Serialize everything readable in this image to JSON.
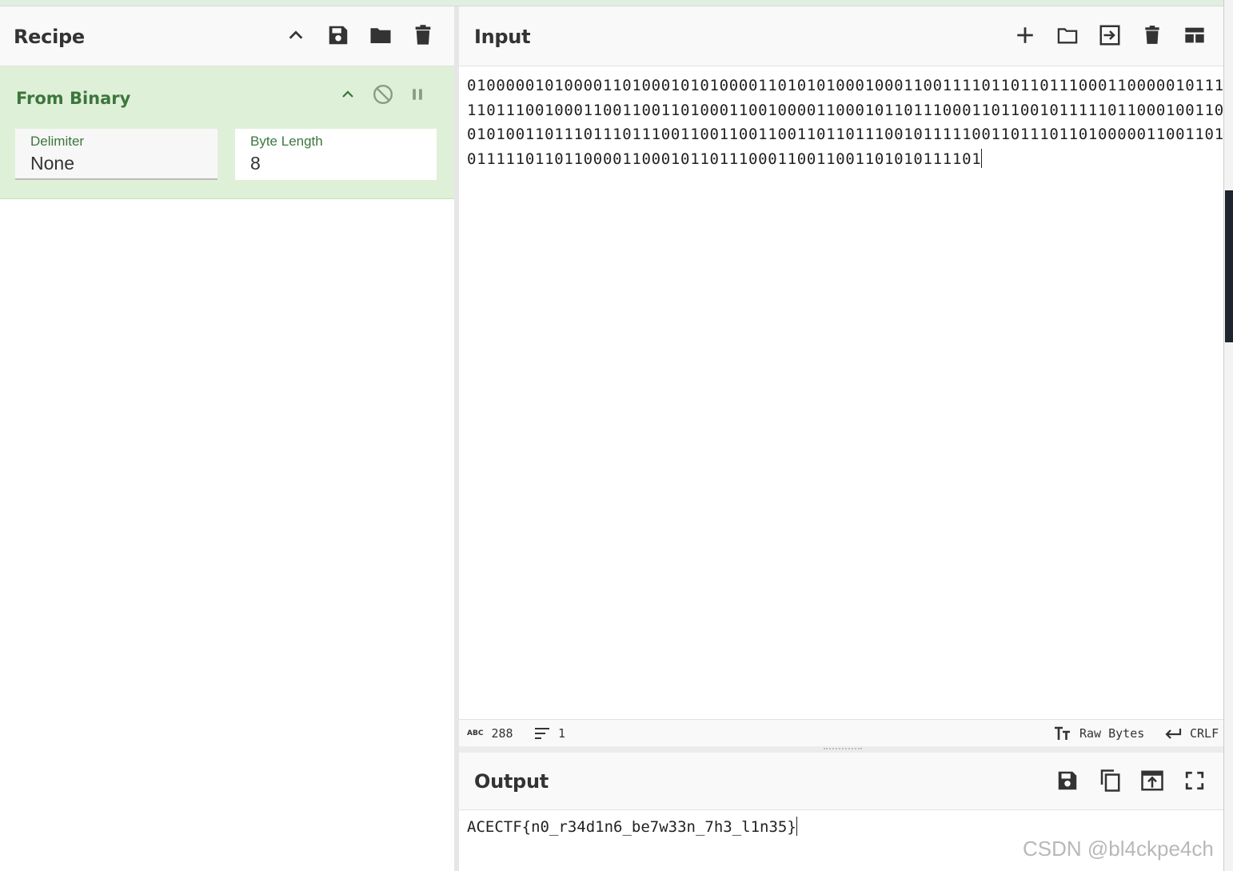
{
  "recipe": {
    "title": "Recipe",
    "header_icons": [
      "chevron-up-icon",
      "save-icon",
      "folder-icon",
      "trash-icon"
    ],
    "operation": {
      "name": "From Binary",
      "icons": [
        "chevron-up-icon",
        "disable-icon",
        "pause-icon"
      ],
      "args": [
        {
          "label": "Delimiter",
          "value": "None"
        },
        {
          "label": "Byte Length",
          "value": "8"
        }
      ]
    }
  },
  "input": {
    "title": "Input",
    "header_icons": [
      "plus-icon",
      "folder-icon",
      "import-icon",
      "trash-icon",
      "layout-icon"
    ],
    "lines": [
      "0100000101000011010001010100001101010100010001100111101101101110001100000101111",
      "1101110010001100110011010001100100001100010110111000110110010111110110001001100",
      "0101001101110111011100110011001100110110111001011111001101110110100000110011010",
      "01111101101100001100010110111000110011001101010111101"
    ]
  },
  "status": {
    "length_label": "ABC",
    "length": "288",
    "lines_count": "1",
    "encoding": "Raw Bytes",
    "eol": "CRLF"
  },
  "output": {
    "title": "Output",
    "header_icons": [
      "save-icon",
      "copy-icon",
      "replace-input-icon",
      "maximize-icon"
    ],
    "text": "ACECTF{n0_r34d1n6_be7w33n_7h3_l1n35}"
  },
  "watermark": "CSDN @bl4ckpe4ch",
  "colors": {
    "operation_bg": "#dff0d8",
    "operation_text": "#3c763d",
    "header_bg": "#f9f9f9"
  }
}
